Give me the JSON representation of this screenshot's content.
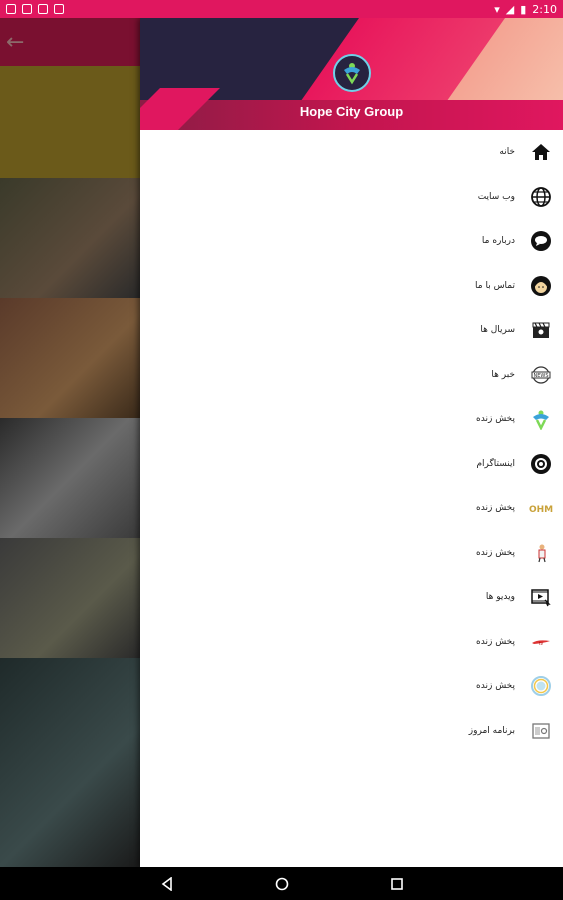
{
  "status_bar": {
    "time": "2:10",
    "accent": "#e0175f"
  },
  "drawer": {
    "brand_title": "Hope City Group",
    "items": [
      {
        "label": "خانه",
        "icon": "home-icon"
      },
      {
        "label": "وب سایت",
        "icon": "globe-icon"
      },
      {
        "label": "درباره ما",
        "icon": "chat-bubble-icon"
      },
      {
        "label": "تماس با ما",
        "icon": "headset-icon"
      },
      {
        "label": "سریال ها",
        "icon": "clapperboard-icon"
      },
      {
        "label": "خبر ها",
        "icon": "news-icon"
      },
      {
        "label": "پخش زنده",
        "icon": "hope-logo-icon"
      },
      {
        "label": "اینستاگرام",
        "icon": "instagram-icon"
      },
      {
        "label": "پخش زنده",
        "icon": "ohm-logo-icon"
      },
      {
        "label": "پخش زنده",
        "icon": "person-icon"
      },
      {
        "label": "ویدیو ها",
        "icon": "video-icon"
      },
      {
        "label": "پخش زنده",
        "icon": "tv-logo-icon"
      },
      {
        "label": "پخش زنده",
        "icon": "rainbow-icon"
      },
      {
        "label": "برنامه امروز",
        "icon": "schedule-icon"
      }
    ]
  },
  "nav_bar": {
    "buttons": [
      "back",
      "home",
      "recents"
    ]
  }
}
